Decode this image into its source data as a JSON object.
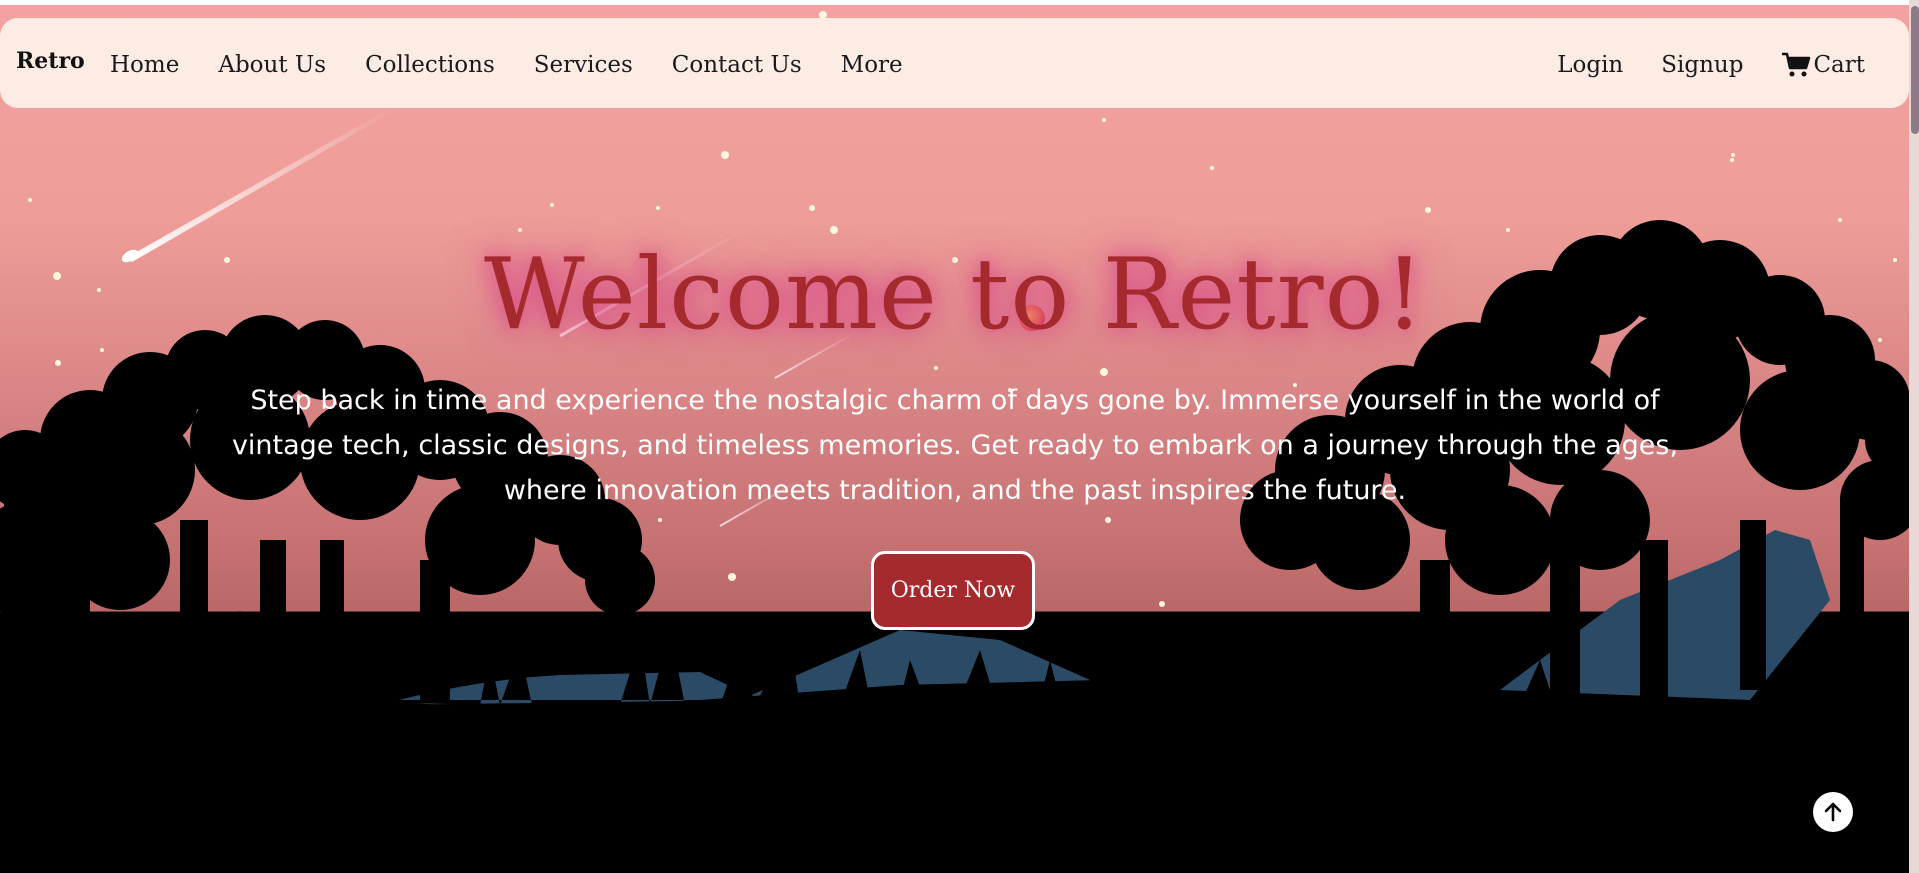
{
  "navbar": {
    "brand": "Retro",
    "left_items": [
      "Home",
      "About Us",
      "Collections",
      "Services",
      "Contact Us",
      "More"
    ],
    "right_items": {
      "login": "Login",
      "signup": "Signup",
      "cart": "Cart"
    }
  },
  "hero": {
    "title": "Welcome to Retro!",
    "description": "Step back in time and experience the nostalgic charm of days gone by. Immerse yourself in the world of vintage tech, classic designs, and timeless memories. Get ready to embark on a journey through the ages, where innovation meets tradition, and the past inspires the future.",
    "button": "Order Now"
  },
  "icons": {
    "cart": "shopping-cart-icon",
    "scroll_top": "arrow-up-icon"
  },
  "colors": {
    "accent": "#a52a2e",
    "nav_bg": "#fdece4",
    "title_glow": "#d8418a"
  }
}
